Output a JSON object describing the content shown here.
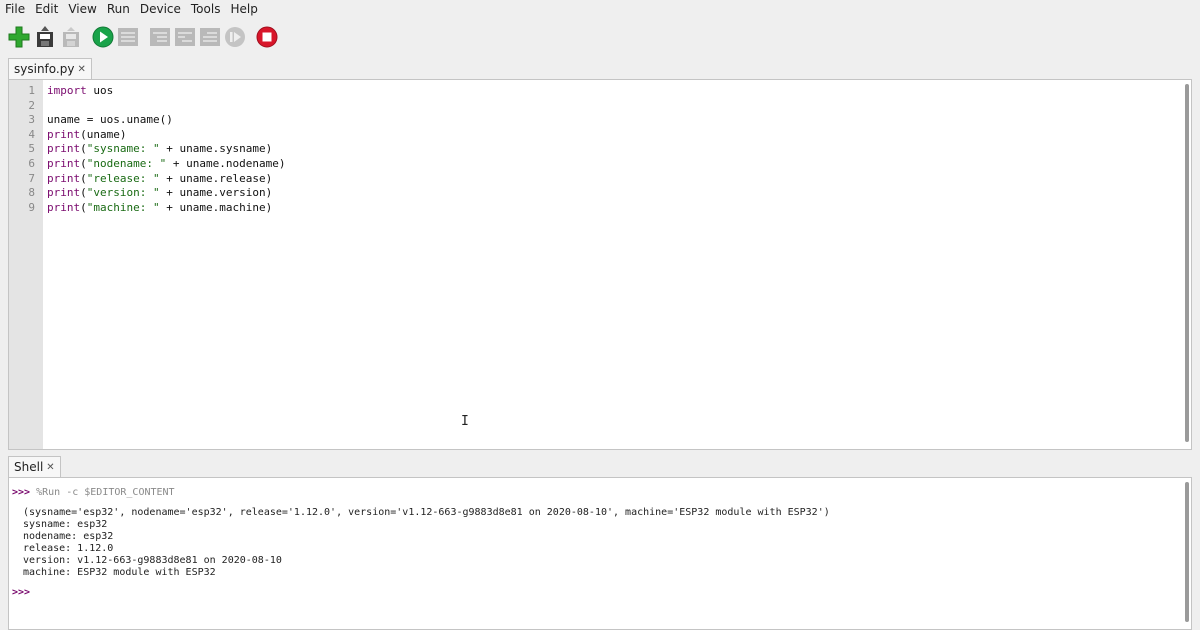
{
  "menu": [
    "File",
    "Edit",
    "View",
    "Run",
    "Device",
    "Tools",
    "Help"
  ],
  "toolbar": {
    "icons": [
      "new-file-icon",
      "open-file-icon",
      "save-file-icon",
      "run-icon",
      "debug-icon",
      "step-over-icon",
      "step-into-icon",
      "step-out-icon",
      "resume-icon",
      "stop-icon"
    ],
    "colors": {
      "new": "#2fa82f",
      "run": "#1aa34a",
      "stop": "#d8162a",
      "disabled": "#b9b9b9"
    }
  },
  "editor": {
    "tab_label": "sysinfo.py",
    "close_glyph": "✕",
    "line_numbers": [
      "1",
      "2",
      "3",
      "4",
      "5",
      "6",
      "7",
      "8",
      "9"
    ],
    "lines": [
      [
        {
          "t": "import",
          "c": "kw"
        },
        {
          "t": " uos",
          "c": ""
        }
      ],
      [],
      [
        {
          "t": "uname = uos.uname()",
          "c": ""
        }
      ],
      [
        {
          "t": "print",
          "c": "fn"
        },
        {
          "t": "(uname)",
          "c": ""
        }
      ],
      [
        {
          "t": "print",
          "c": "fn"
        },
        {
          "t": "(",
          "c": ""
        },
        {
          "t": "\"sysname: \"",
          "c": "str"
        },
        {
          "t": " + uname.sysname)",
          "c": ""
        }
      ],
      [
        {
          "t": "print",
          "c": "fn"
        },
        {
          "t": "(",
          "c": ""
        },
        {
          "t": "\"nodename: \"",
          "c": "str"
        },
        {
          "t": " + uname.nodename)",
          "c": ""
        }
      ],
      [
        {
          "t": "print",
          "c": "fn"
        },
        {
          "t": "(",
          "c": ""
        },
        {
          "t": "\"release: \"",
          "c": "str"
        },
        {
          "t": " + uname.release)",
          "c": ""
        }
      ],
      [
        {
          "t": "print",
          "c": "fn"
        },
        {
          "t": "(",
          "c": ""
        },
        {
          "t": "\"version: \"",
          "c": "str"
        },
        {
          "t": " + uname.version)",
          "c": ""
        }
      ],
      [
        {
          "t": "print",
          "c": "fn"
        },
        {
          "t": "(",
          "c": ""
        },
        {
          "t": "\"machine: \"",
          "c": "str"
        },
        {
          "t": " + uname.machine)",
          "c": ""
        }
      ]
    ]
  },
  "shell": {
    "tab_label": "Shell",
    "close_glyph": "✕",
    "prompt": ">>>",
    "command": "%Run -c $EDITOR_CONTENT",
    "output": [
      "(sysname='esp32', nodename='esp32', release='1.12.0', version='v1.12-663-g9883d8e81 on 2020-08-10', machine='ESP32 module with ESP32')",
      "sysname: esp32",
      "nodename: esp32",
      "release: 1.12.0",
      "version: v1.12-663-g9883d8e81 on 2020-08-10",
      "machine: ESP32 module with ESP32"
    ],
    "final_prompt": ">>>"
  }
}
